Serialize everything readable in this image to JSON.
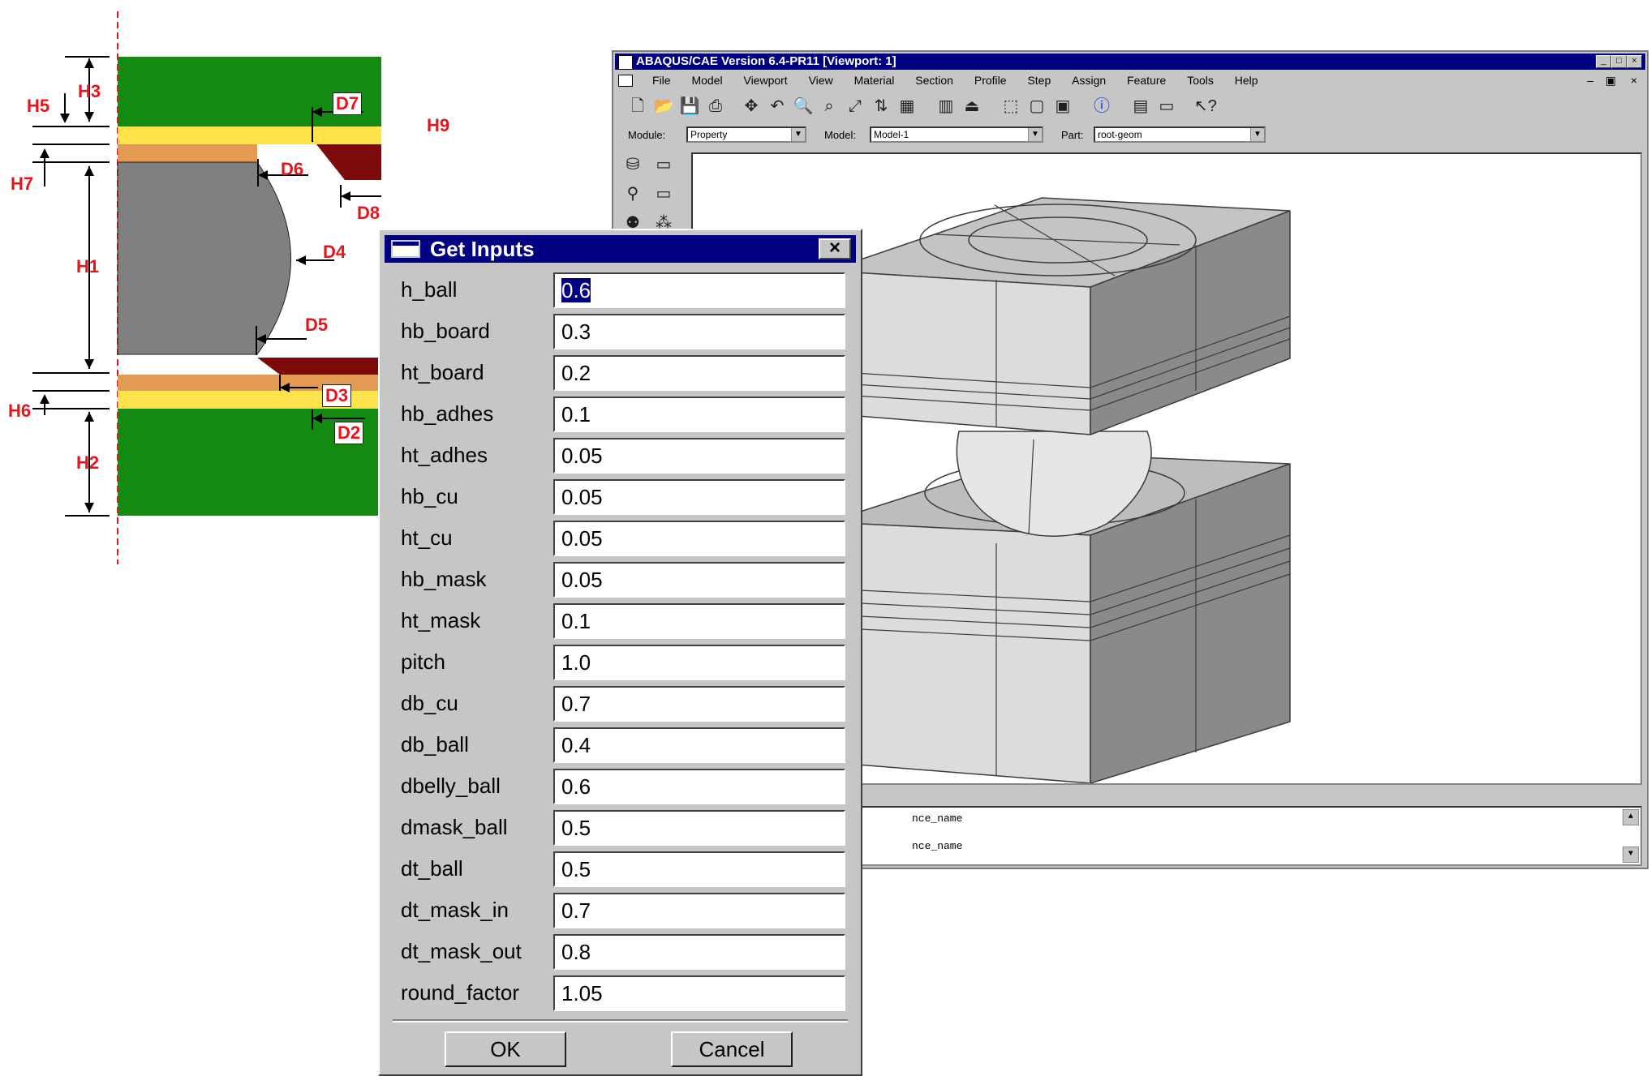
{
  "diagram": {
    "labels": {
      "h3": "H3",
      "h5": "H5",
      "h7": "H7",
      "h1": "H1",
      "h6": "H6",
      "h2": "H2",
      "h9": "H9",
      "d7": "D7",
      "d6": "D6",
      "d8": "D8",
      "d4": "D4",
      "d5": "D5",
      "d3": "D3",
      "d2": "D2"
    },
    "colors": {
      "board": "#138b12",
      "adhesive": "#ffe34d",
      "copper": "#e39a52",
      "mask": "#7d0a0a",
      "ball": "#808080",
      "dim": "#e8141c"
    }
  },
  "abaqus": {
    "title": "ABAQUS/CAE Version 6.4-PR11 [Viewport: 1]",
    "menu": [
      "File",
      "Model",
      "Viewport",
      "View",
      "Material",
      "Section",
      "Profile",
      "Step",
      "Assign",
      "Feature",
      "Tools",
      "Help"
    ],
    "context": {
      "module_label": "Module:",
      "module_value": "Property",
      "model_label": "Model:",
      "model_value": "Model-1",
      "part_label": "Part:",
      "part_value": "root-geom"
    },
    "messages": [
      "nce_name",
      "nce_name"
    ]
  },
  "dialog": {
    "title": "Get Inputs",
    "fields": [
      {
        "label": "h_ball",
        "value": "0.6"
      },
      {
        "label": "hb_board",
        "value": "0.3"
      },
      {
        "label": "ht_board",
        "value": "0.2"
      },
      {
        "label": "hb_adhes",
        "value": "0.1"
      },
      {
        "label": "ht_adhes",
        "value": "0.05"
      },
      {
        "label": "hb_cu",
        "value": "0.05"
      },
      {
        "label": "ht_cu",
        "value": "0.05"
      },
      {
        "label": "hb_mask",
        "value": "0.05"
      },
      {
        "label": "ht_mask",
        "value": "0.1"
      },
      {
        "label": "pitch",
        "value": "1.0"
      },
      {
        "label": "db_cu",
        "value": "0.7"
      },
      {
        "label": "db_ball",
        "value": "0.4"
      },
      {
        "label": "dbelly_ball",
        "value": "0.6"
      },
      {
        "label": "dmask_ball",
        "value": "0.5"
      },
      {
        "label": "dt_ball",
        "value": "0.5"
      },
      {
        "label": "dt_mask_in",
        "value": "0.7"
      },
      {
        "label": "dt_mask_out",
        "value": "0.8"
      },
      {
        "label": "round_factor",
        "value": "1.05"
      }
    ],
    "ok_label": "OK",
    "cancel_label": "Cancel"
  }
}
